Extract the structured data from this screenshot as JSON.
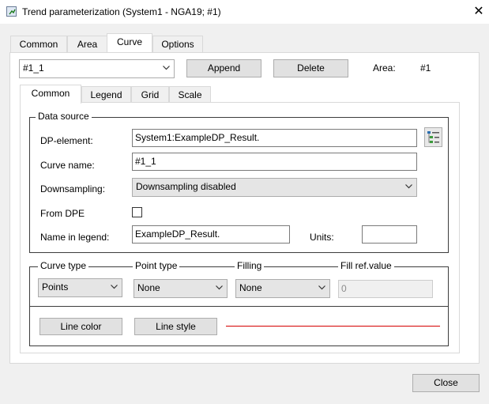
{
  "window": {
    "title": "Trend parameterization (System1 - NGA19; #1)",
    "close_glyph": "✕",
    "icon": "app-window-icon"
  },
  "main_tabs": [
    {
      "label": "Common",
      "active": false
    },
    {
      "label": "Area",
      "active": false
    },
    {
      "label": "Curve",
      "active": true
    },
    {
      "label": "Options",
      "active": false
    }
  ],
  "curve_bar": {
    "curve_select": "#1_1",
    "append_label": "Append",
    "delete_label": "Delete",
    "area_label": "Area:",
    "area_value": "#1"
  },
  "sub_tabs": [
    {
      "label": "Common",
      "active": true
    },
    {
      "label": "Legend",
      "active": false
    },
    {
      "label": "Grid",
      "active": false
    },
    {
      "label": "Scale",
      "active": false
    }
  ],
  "data_source": {
    "legend": "Data source",
    "dp_element_label": "DP-element:",
    "dp_element_value": "System1:ExampleDP_Result.",
    "curve_name_label": "Curve name:",
    "curve_name_value": "#1_1",
    "downsampling_label": "Downsampling:",
    "downsampling_value": "Downsampling disabled",
    "from_dpe_label": "From DPE",
    "from_dpe_checked": false,
    "name_in_legend_label": "Name in legend:",
    "name_in_legend_value": "ExampleDP_Result.",
    "units_label": "Units:",
    "units_value": ""
  },
  "curve_settings": {
    "curve_type_label": "Curve type",
    "curve_type_value": "Points",
    "point_type_label": "Point type",
    "point_type_value": "None",
    "filling_label": "Filling",
    "filling_value": "None",
    "fill_ref_label": "Fill ref.value",
    "fill_ref_value": "0",
    "line_color_label": "Line color",
    "line_style_label": "Line style",
    "line_color": "#d40000"
  },
  "footer": {
    "close_label": "Close"
  }
}
